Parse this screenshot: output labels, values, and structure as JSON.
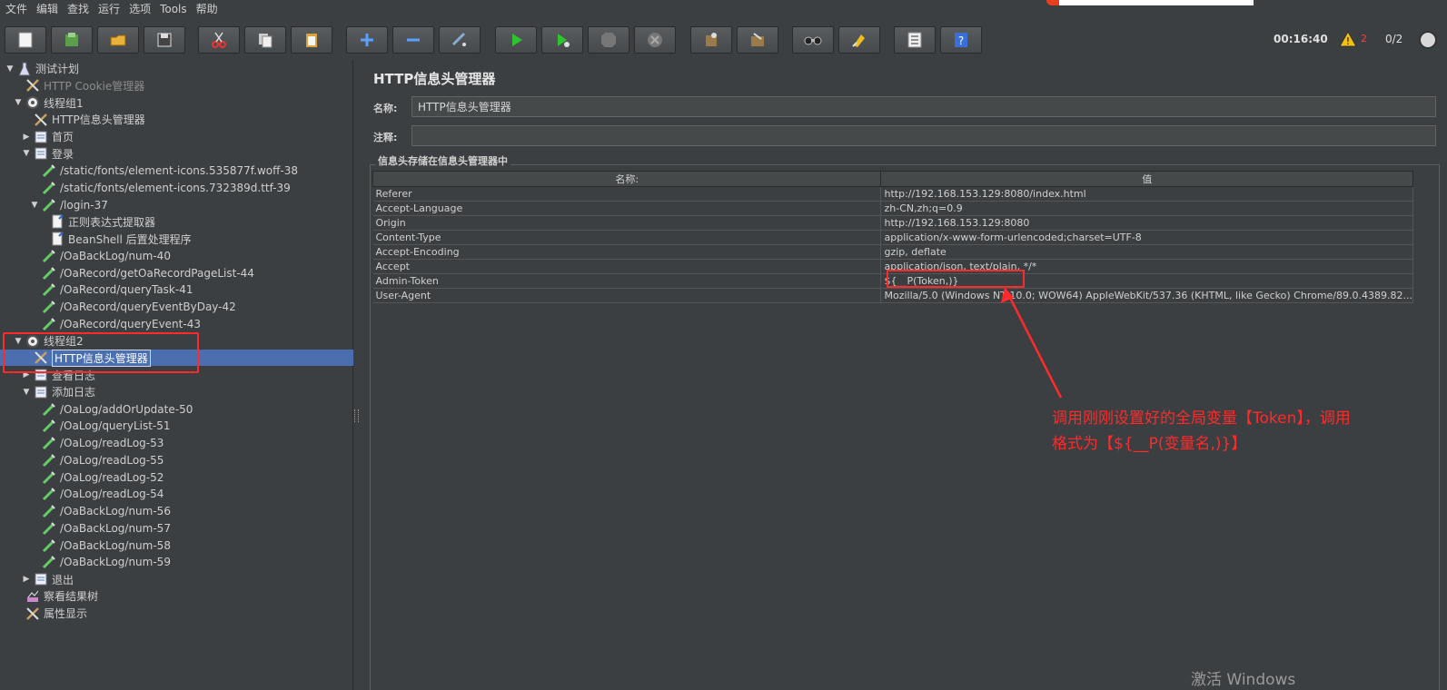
{
  "menu": {
    "items": [
      "文件",
      "编辑",
      "查找",
      "运行",
      "选项",
      "Tools",
      "帮助"
    ]
  },
  "toolbar": {
    "buttons": [
      "new-icon",
      "templates-icon",
      "open-icon",
      "save-icon",
      "cut-icon",
      "copy-icon",
      "paste-icon",
      "expand-icon",
      "collapse-icon",
      "toggle-icon",
      "start-icon",
      "start-no-pause-icon",
      "stop-icon",
      "shutdown-icon",
      "clear-icon",
      "clear-all-icon",
      "search-icon",
      "reset-search-icon",
      "function-helper-icon",
      "help-icon"
    ],
    "timer": "00:16:40",
    "warning_count": "2",
    "threads": "0/2"
  },
  "tree": {
    "items": [
      {
        "label": "测试计划",
        "icon": "test-plan-icon",
        "arrow": "▼",
        "level": 0
      },
      {
        "label": "HTTP Cookie管理器",
        "icon": "config-element-icon",
        "arrow": "",
        "level": 1,
        "dim": true
      },
      {
        "label": "线程组1",
        "icon": "thread-group-icon",
        "arrow": "▼",
        "level": 1
      },
      {
        "label": "HTTP信息头管理器",
        "icon": "config-element-icon",
        "arrow": "",
        "level": 2
      },
      {
        "label": "首页",
        "icon": "transaction-controller-icon",
        "arrow": "▶",
        "level": 2
      },
      {
        "label": "登录",
        "icon": "transaction-controller-icon",
        "arrow": "▼",
        "level": 2
      },
      {
        "label": "/static/fonts/element-icons.535877f.woff-38",
        "icon": "sampler-icon",
        "arrow": "",
        "level": 3
      },
      {
        "label": "/static/fonts/element-icons.732389d.ttf-39",
        "icon": "sampler-icon",
        "arrow": "",
        "level": 3
      },
      {
        "label": "/login-37",
        "icon": "sampler-icon",
        "arrow": "▼",
        "level": 3
      },
      {
        "label": "正则表达式提取器",
        "icon": "post-processor-icon",
        "arrow": "",
        "level": 4
      },
      {
        "label": "BeanShell 后置处理程序",
        "icon": "post-processor-icon",
        "arrow": "",
        "level": 4
      },
      {
        "label": "/OaBackLog/num-40",
        "icon": "sampler-icon",
        "arrow": "",
        "level": 3
      },
      {
        "label": "/OaRecord/getOaRecordPageList-44",
        "icon": "sampler-icon",
        "arrow": "",
        "level": 3
      },
      {
        "label": "/OaRecord/queryTask-41",
        "icon": "sampler-icon",
        "arrow": "",
        "level": 3
      },
      {
        "label": "/OaRecord/queryEventByDay-42",
        "icon": "sampler-icon",
        "arrow": "",
        "level": 3
      },
      {
        "label": "/OaRecord/queryEvent-43",
        "icon": "sampler-icon",
        "arrow": "",
        "level": 3
      },
      {
        "label": "线程组2",
        "icon": "thread-group-icon",
        "arrow": "▼",
        "level": 1
      },
      {
        "label": "HTTP信息头管理器",
        "icon": "config-element-icon",
        "arrow": "",
        "level": 2,
        "selected": true
      },
      {
        "label": "查看日志",
        "icon": "transaction-controller-icon",
        "arrow": "▶",
        "level": 2
      },
      {
        "label": "添加日志",
        "icon": "transaction-controller-icon",
        "arrow": "▼",
        "level": 2
      },
      {
        "label": "/OaLog/addOrUpdate-50",
        "icon": "sampler-icon",
        "arrow": "",
        "level": 3
      },
      {
        "label": "/OaLog/queryList-51",
        "icon": "sampler-icon",
        "arrow": "",
        "level": 3
      },
      {
        "label": "/OaLog/readLog-53",
        "icon": "sampler-icon",
        "arrow": "",
        "level": 3
      },
      {
        "label": "/OaLog/readLog-55",
        "icon": "sampler-icon",
        "arrow": "",
        "level": 3
      },
      {
        "label": "/OaLog/readLog-52",
        "icon": "sampler-icon",
        "arrow": "",
        "level": 3
      },
      {
        "label": "/OaLog/readLog-54",
        "icon": "sampler-icon",
        "arrow": "",
        "level": 3
      },
      {
        "label": "/OaBackLog/num-56",
        "icon": "sampler-icon",
        "arrow": "",
        "level": 3
      },
      {
        "label": "/OaBackLog/num-57",
        "icon": "sampler-icon",
        "arrow": "",
        "level": 3
      },
      {
        "label": "/OaBackLog/num-58",
        "icon": "sampler-icon",
        "arrow": "",
        "level": 3
      },
      {
        "label": "/OaBackLog/num-59",
        "icon": "sampler-icon",
        "arrow": "",
        "level": 3
      },
      {
        "label": "退出",
        "icon": "transaction-controller-icon",
        "arrow": "▶",
        "level": 2
      },
      {
        "label": "察看结果树",
        "icon": "listener-icon",
        "arrow": "",
        "level": 1
      },
      {
        "label": "属性显示",
        "icon": "config-element-icon",
        "arrow": "",
        "level": 1
      }
    ]
  },
  "panel": {
    "title": "HTTP信息头管理器",
    "name_label": "名称:",
    "name_value": "HTTP信息头管理器",
    "comment_label": "注释:",
    "comment_value": "",
    "group_title": "信息头存储在信息头管理器中",
    "table": {
      "headers": [
        "名称:",
        "值"
      ],
      "rows": [
        [
          "Referer",
          "http://192.168.153.129:8080/index.html"
        ],
        [
          "Accept-Language",
          "zh-CN,zh;q=0.9"
        ],
        [
          "Origin",
          "http://192.168.153.129:8080"
        ],
        [
          "Content-Type",
          "application/x-www-form-urlencoded;charset=UTF-8"
        ],
        [
          "Accept-Encoding",
          "gzip, deflate"
        ],
        [
          "Accept",
          "application/json, text/plain, */*"
        ],
        [
          "Admin-Token",
          "${__P(Token,)}"
        ],
        [
          "User-Agent",
          "Mozilla/5.0 (Windows NT 10.0; WOW64) AppleWebKit/537.36 (KHTML, like Gecko) Chrome/89.0.4389.82..."
        ]
      ]
    }
  },
  "annotation": {
    "line1": "调用刚刚设置好的全局变量【Token】，调用",
    "line2": "格式为【${__P(变量名,)}】"
  },
  "watermark": "激活 Windows",
  "colors": {
    "background": "#3c3f41",
    "selection": "#4b6eaf",
    "annotation_red": "#ff2a2a"
  }
}
